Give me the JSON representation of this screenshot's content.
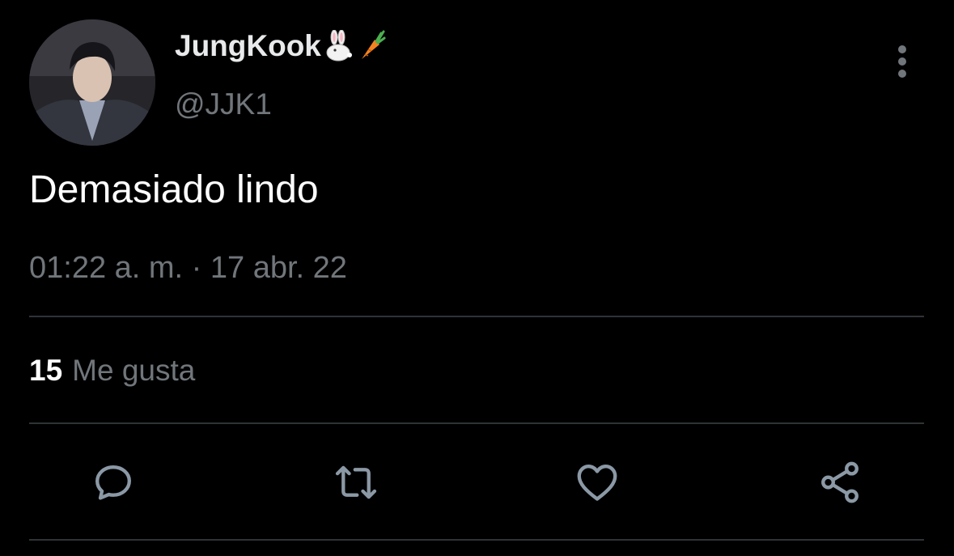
{
  "tweet": {
    "author": {
      "display_name": "JungKook",
      "name_emojis": [
        "rabbit-icon",
        "carrot-icon"
      ],
      "handle": "@JJK1"
    },
    "text": "Demasiado lindo",
    "timestamp": "01:22 a. m. · 17 abr. 22",
    "likes": {
      "count": "15",
      "label": "Me gusta"
    }
  },
  "actions": [
    "reply-icon",
    "retweet-icon",
    "like-icon",
    "share-icon"
  ],
  "colors": {
    "background": "#000000",
    "primary_text": "#e7e9ea",
    "secondary_text": "#71767b",
    "divider": "#2f3336",
    "icon": "#8b98a5"
  }
}
